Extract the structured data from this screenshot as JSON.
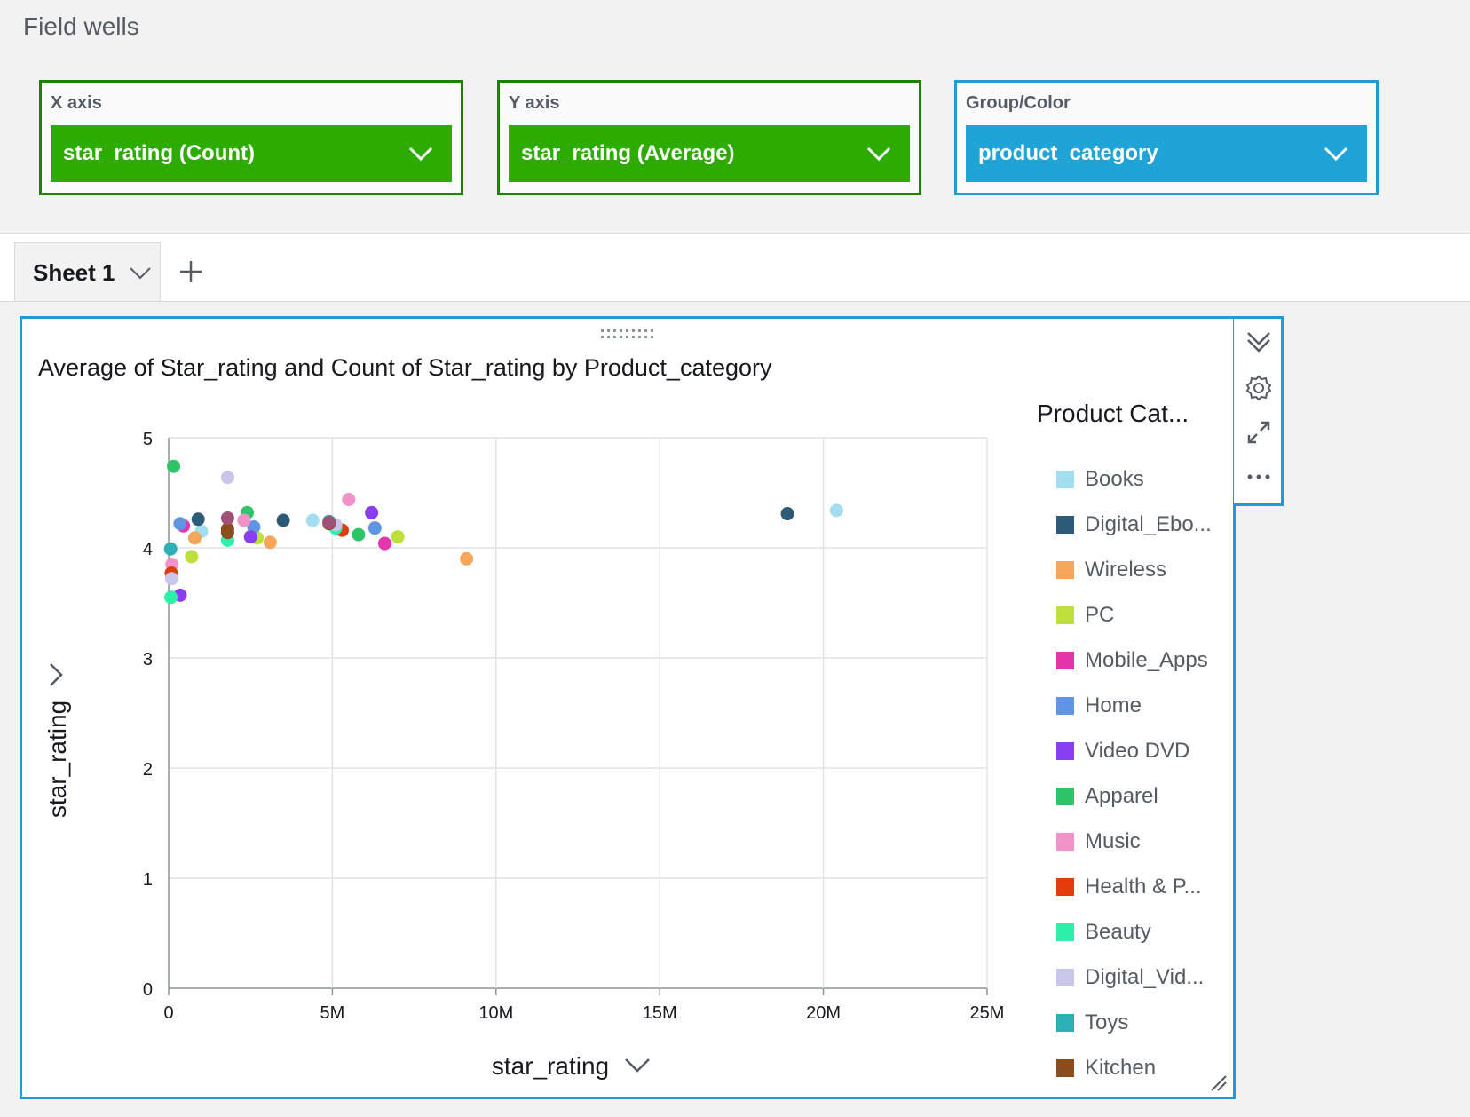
{
  "field_wells": {
    "title": "Field wells",
    "x_axis": {
      "label": "X axis",
      "value": "star_rating (Count)"
    },
    "y_axis": {
      "label": "Y axis",
      "value": "star_rating (Average)"
    },
    "group_color": {
      "label": "Group/Color",
      "value": "product_category"
    }
  },
  "sheets": {
    "active": "Sheet 1"
  },
  "visual": {
    "title": "Average of Star_rating and Count of Star_rating by Product_category",
    "legend_title": "Product Cat...",
    "x_axis_label": "star_rating",
    "y_axis_label": "star_rating"
  },
  "colors": {
    "accent_green": "#2eab00",
    "accent_blue": "#20a4d8",
    "selection_border": "#1f9bd7"
  },
  "chart_data": {
    "type": "scatter",
    "title": "Average of Star_rating and Count of Star_rating by Product_category",
    "xlabel": "star_rating",
    "ylabel": "star_rating",
    "xlim": [
      0,
      25000000
    ],
    "ylim": [
      0,
      5
    ],
    "x_ticks": [
      "0",
      "5M",
      "10M",
      "15M",
      "20M",
      "25M"
    ],
    "y_ticks": [
      "0",
      "1",
      "2",
      "3",
      "4",
      "5"
    ],
    "grid": true,
    "legend": {
      "title": "Product Cat...",
      "position": "right",
      "entries": [
        {
          "label": "Books",
          "color": "#a3ddf0"
        },
        {
          "label": "Digital_Ebo...",
          "color": "#2d5a77"
        },
        {
          "label": "Wireless",
          "color": "#f5a65b"
        },
        {
          "label": "PC",
          "color": "#bde03b"
        },
        {
          "label": "Mobile_Apps",
          "color": "#e535ab"
        },
        {
          "label": "Home",
          "color": "#5f95e3"
        },
        {
          "label": "Video DVD",
          "color": "#8a3ef0"
        },
        {
          "label": "Apparel",
          "color": "#2ec46a"
        },
        {
          "label": "Music",
          "color": "#ef93c9"
        },
        {
          "label": "Health & P...",
          "color": "#e23c0c"
        },
        {
          "label": "Beauty",
          "color": "#2ef0a8"
        },
        {
          "label": "Digital_Vid...",
          "color": "#c8c6ea"
        },
        {
          "label": "Toys",
          "color": "#2cb0b6"
        },
        {
          "label": "Kitchen",
          "color": "#8b4d1b"
        }
      ]
    },
    "points": [
      {
        "x": 20400000,
        "y": 4.34,
        "color": "#a3ddf0"
      },
      {
        "x": 18900000,
        "y": 4.31,
        "color": "#2d5a77"
      },
      {
        "x": 9100000,
        "y": 3.9,
        "color": "#f5a65b"
      },
      {
        "x": 7000000,
        "y": 4.1,
        "color": "#bde03b"
      },
      {
        "x": 6600000,
        "y": 4.04,
        "color": "#e535ab"
      },
      {
        "x": 6300000,
        "y": 4.18,
        "color": "#5f95e3"
      },
      {
        "x": 6200000,
        "y": 4.32,
        "color": "#8a3ef0"
      },
      {
        "x": 5800000,
        "y": 4.12,
        "color": "#2ec46a"
      },
      {
        "x": 5500000,
        "y": 4.44,
        "color": "#ef93c9"
      },
      {
        "x": 5300000,
        "y": 4.16,
        "color": "#e23c0c"
      },
      {
        "x": 5100000,
        "y": 4.18,
        "color": "#2ef0a8"
      },
      {
        "x": 5100000,
        "y": 4.21,
        "color": "#c8c6ea"
      },
      {
        "x": 4900000,
        "y": 4.24,
        "color": "#2cb0b6"
      },
      {
        "x": 4900000,
        "y": 4.22,
        "color": "#8b4d1b"
      },
      {
        "x": 4900000,
        "y": 4.23,
        "color": "#a05276"
      },
      {
        "x": 4400000,
        "y": 4.25,
        "color": "#a3ddf0"
      },
      {
        "x": 3500000,
        "y": 4.25,
        "color": "#2d5a77"
      },
      {
        "x": 3100000,
        "y": 4.05,
        "color": "#f5a65b"
      },
      {
        "x": 2700000,
        "y": 4.09,
        "color": "#bde03b"
      },
      {
        "x": 2600000,
        "y": 4.19,
        "color": "#5f95e3"
      },
      {
        "x": 2500000,
        "y": 4.1,
        "color": "#8a3ef0"
      },
      {
        "x": 2400000,
        "y": 4.32,
        "color": "#2ec46a"
      },
      {
        "x": 2300000,
        "y": 4.25,
        "color": "#ef93c9"
      },
      {
        "x": 1800000,
        "y": 4.07,
        "color": "#2ef0a8"
      },
      {
        "x": 1800000,
        "y": 4.14,
        "color": "#8b4d1b"
      },
      {
        "x": 1800000,
        "y": 4.17,
        "color": "#8b4d1b"
      },
      {
        "x": 1800000,
        "y": 4.27,
        "color": "#a05276"
      },
      {
        "x": 1800000,
        "y": 4.64,
        "color": "#c8c6ea"
      },
      {
        "x": 1000000,
        "y": 4.15,
        "color": "#a3ddf0"
      },
      {
        "x": 900000,
        "y": 4.26,
        "color": "#2d5a77"
      },
      {
        "x": 800000,
        "y": 4.09,
        "color": "#f5a65b"
      },
      {
        "x": 700000,
        "y": 3.92,
        "color": "#bde03b"
      },
      {
        "x": 450000,
        "y": 4.2,
        "color": "#e535ab"
      },
      {
        "x": 350000,
        "y": 4.22,
        "color": "#5f95e3"
      },
      {
        "x": 350000,
        "y": 3.57,
        "color": "#8a3ef0"
      },
      {
        "x": 150000,
        "y": 4.74,
        "color": "#2ec46a"
      },
      {
        "x": 100000,
        "y": 3.85,
        "color": "#ef93c9"
      },
      {
        "x": 80000,
        "y": 3.77,
        "color": "#e23c0c"
      },
      {
        "x": 70000,
        "y": 3.55,
        "color": "#2ef0a8"
      },
      {
        "x": 90000,
        "y": 3.72,
        "color": "#c8c6ea"
      },
      {
        "x": 60000,
        "y": 3.99,
        "color": "#2cb0b6"
      }
    ]
  }
}
